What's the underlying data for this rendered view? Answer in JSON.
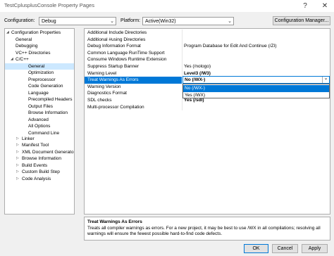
{
  "window": {
    "title": "TestCplusplusConsole Property Pages",
    "help_glyph": "?",
    "close_glyph": "✕"
  },
  "toolbar": {
    "configuration_label": "Configuration:",
    "configuration_value": "Debug",
    "platform_label": "Platform:",
    "platform_value": "Active(Win32)",
    "configuration_manager_label": "Configuration Manager..."
  },
  "tree": {
    "items": [
      {
        "label": "Configuration Properties",
        "expander": "◢"
      },
      {
        "label": "General",
        "expander": ""
      },
      {
        "label": "Debugging",
        "expander": ""
      },
      {
        "label": "VC++ Directories",
        "expander": ""
      },
      {
        "label": "C/C++",
        "expander": "◢"
      },
      {
        "label": "General",
        "expander": ""
      },
      {
        "label": "Optimization",
        "expander": ""
      },
      {
        "label": "Preprocessor",
        "expander": ""
      },
      {
        "label": "Code Generation",
        "expander": ""
      },
      {
        "label": "Language",
        "expander": ""
      },
      {
        "label": "Precompiled Headers",
        "expander": ""
      },
      {
        "label": "Output Files",
        "expander": ""
      },
      {
        "label": "Browse Information",
        "expander": ""
      },
      {
        "label": "Advanced",
        "expander": ""
      },
      {
        "label": "All Options",
        "expander": ""
      },
      {
        "label": "Command Line",
        "expander": ""
      },
      {
        "label": "Linker",
        "expander": "▷"
      },
      {
        "label": "Manifest Tool",
        "expander": "▷"
      },
      {
        "label": "XML Document Generator",
        "expander": "▷"
      },
      {
        "label": "Browse Information",
        "expander": "▷"
      },
      {
        "label": "Build Events",
        "expander": "▷"
      },
      {
        "label": "Custom Build Step",
        "expander": "▷"
      },
      {
        "label": "Code Analysis",
        "expander": "▷"
      }
    ]
  },
  "grid": {
    "rows": [
      {
        "name": "Additional Include Directories",
        "value": ""
      },
      {
        "name": "Additional #using Directories",
        "value": ""
      },
      {
        "name": "Debug Information Format",
        "value": "Program Database for Edit And Continue (/ZI)"
      },
      {
        "name": "Common Language RunTime Support",
        "value": ""
      },
      {
        "name": "Consume Windows Runtime Extension",
        "value": ""
      },
      {
        "name": "Suppress Startup Banner",
        "value": "Yes (/nologo)"
      },
      {
        "name": "Warning Level",
        "value": "Level3 (/W3)"
      },
      {
        "name": "Treat Warnings As Errors",
        "value": "No (/WX-)"
      },
      {
        "name": "Warning Version",
        "value": ""
      },
      {
        "name": "Diagnostics Format",
        "value": ""
      },
      {
        "name": "SDL checks",
        "value": "Yes (/sdl)"
      },
      {
        "name": "Multi-processor Compilation",
        "value": ""
      }
    ],
    "dropdown": {
      "current": "No (/WX-)",
      "options": [
        "No (/WX-)",
        "Yes (/WX)"
      ],
      "arrow": "⌄"
    }
  },
  "description": {
    "title": "Treat Warnings As Errors",
    "text": "Treats all compiler warnings as errors. For a new project, it may be best to use /WX in all compilations; resolving all warnings will ensure the fewest possible hard-to-find code defects."
  },
  "footer": {
    "ok_label": "OK",
    "cancel_label": "Cancel",
    "apply_label": "Apply"
  }
}
